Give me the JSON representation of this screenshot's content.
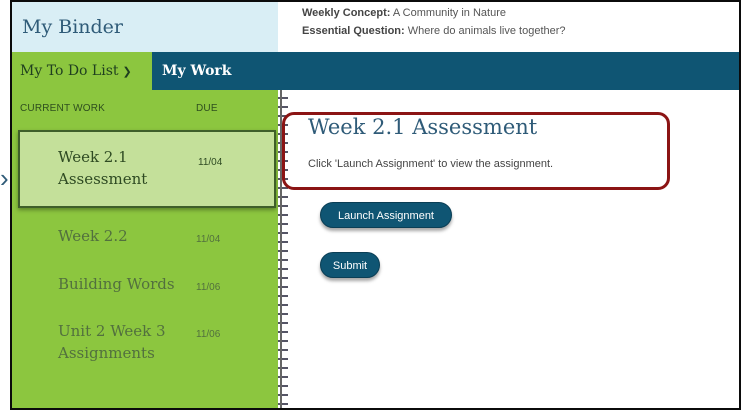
{
  "header": {
    "binder_title": "My Binder",
    "weekly_concept_label": "Weekly Concept:",
    "weekly_concept_value": "A Community in Nature",
    "essential_question_label": "Essential Question:",
    "essential_question_value": "Where do animals live together?"
  },
  "nav": {
    "todo_tab": "My To Do List",
    "work_tab": "My Work"
  },
  "sidebar": {
    "col_current": "CURRENT WORK",
    "col_due": "DUE",
    "items": [
      {
        "name": "Week 2.1 Assessment",
        "due": "11/04"
      },
      {
        "name": "Week 2.2",
        "due": "11/04"
      },
      {
        "name": "Building Words",
        "due": "11/06"
      },
      {
        "name": "Unit 2 Week 3 Assignments",
        "due": "11/06"
      }
    ]
  },
  "main": {
    "title": "Week 2.1 Assessment",
    "instruction": "Click 'Launch Assignment' to view the assignment.",
    "launch_button": "Launch Assignment",
    "submit_button": "Submit"
  },
  "colors": {
    "nav_bg": "#0f5573",
    "sidebar_bg": "#8cc63f",
    "active_item_bg": "#c4e09a",
    "highlight_border": "#8b1414"
  }
}
